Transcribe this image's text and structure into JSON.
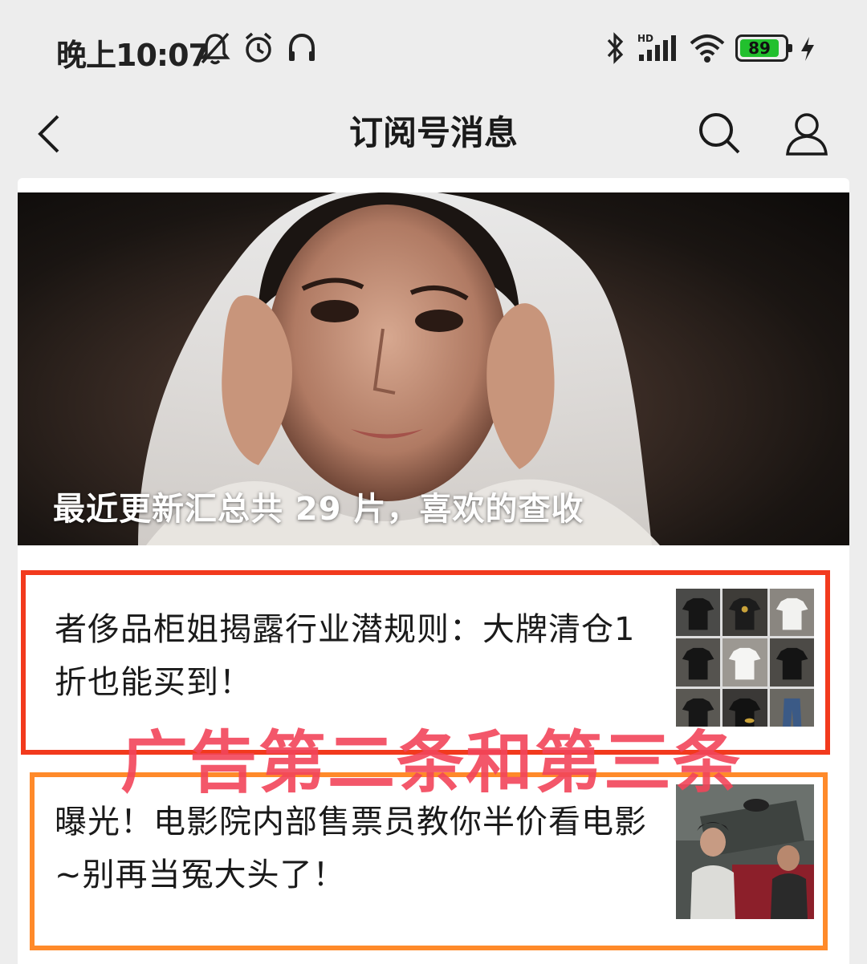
{
  "status_bar": {
    "time": "晚上10:07",
    "battery_level": "89",
    "icons_left": [
      "mute-bell-icon",
      "alarm-icon",
      "headset-icon"
    ],
    "icons_right": [
      "bluetooth-icon",
      "hd-signal-icon",
      "wifi-icon",
      "battery-icon",
      "charging-icon"
    ]
  },
  "nav": {
    "title": "订阅号消息",
    "back_icon": "chevron-left-icon",
    "search_icon": "search-icon",
    "profile_icon": "person-icon"
  },
  "hero": {
    "caption": "最近更新汇总共 29 片，喜欢的查收"
  },
  "articles": [
    {
      "title": "者侈品柜姐揭露行业潜规则：大牌清仓1折也能买到！",
      "thumb": "clothing-grid-thumbnail"
    },
    {
      "title": "曝光！电影院内部售票员教你半价看电影~别再当冤大头了！",
      "thumb": "movie-still-thumbnail"
    }
  ],
  "annotation": {
    "label": "广告第二条和第三条",
    "red_box_color": "#f23a1d",
    "orange_box_color": "#ff8a2a",
    "label_color": "#f2455a"
  }
}
